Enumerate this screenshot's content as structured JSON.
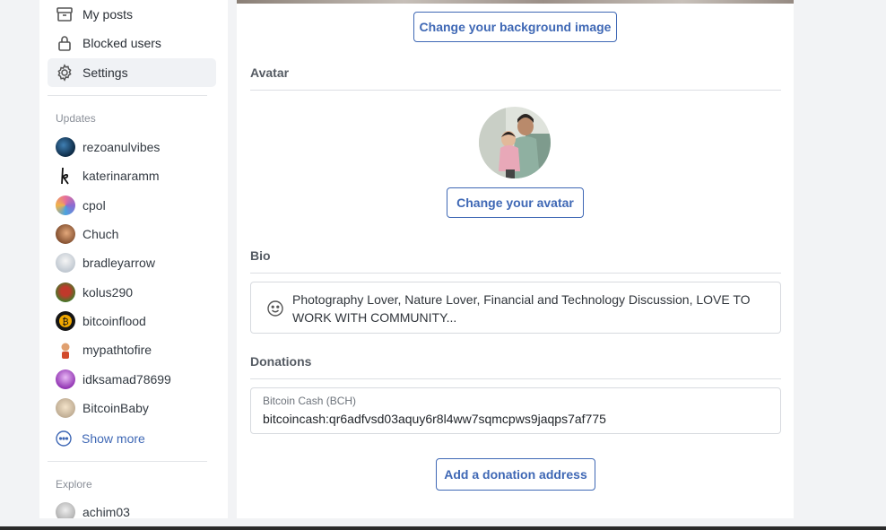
{
  "sidebar": {
    "nav": [
      {
        "label": "My posts",
        "icon": "archive-icon"
      },
      {
        "label": "Blocked users",
        "icon": "lock-icon"
      },
      {
        "label": "Settings",
        "icon": "gear-icon",
        "active": true
      }
    ],
    "updates_title": "Updates",
    "updates": [
      {
        "name": "rezoanulvibes"
      },
      {
        "name": "katerinaramm"
      },
      {
        "name": "cpol"
      },
      {
        "name": "Chuch"
      },
      {
        "name": "bradleyarrow"
      },
      {
        "name": "kolus290"
      },
      {
        "name": "bitcoinflood"
      },
      {
        "name": "mypathtofire"
      },
      {
        "name": "idksamad78699"
      },
      {
        "name": "BitcoinBaby"
      }
    ],
    "show_more": "Show more",
    "explore_title": "Explore",
    "explore": [
      {
        "name": "achim03"
      }
    ]
  },
  "main": {
    "change_background": "Change your background image",
    "avatar_title": "Avatar",
    "change_avatar": "Change your avatar",
    "bio_title": "Bio",
    "bio_text": "Photography Lover, Nature Lover, Financial and Technology Discussion, LOVE TO WORK WITH COMMUNITY...",
    "donations_title": "Donations",
    "donation": {
      "label": "Bitcoin Cash (BCH)",
      "address": "bitcoincash:qr6adfvsd03aquy6r8l4ww7sqmcpws9jaqps7af775"
    },
    "add_donation": "Add a donation address"
  },
  "colors": {
    "accent": "#3f68b5",
    "page_bg": "#f2f3f5"
  }
}
